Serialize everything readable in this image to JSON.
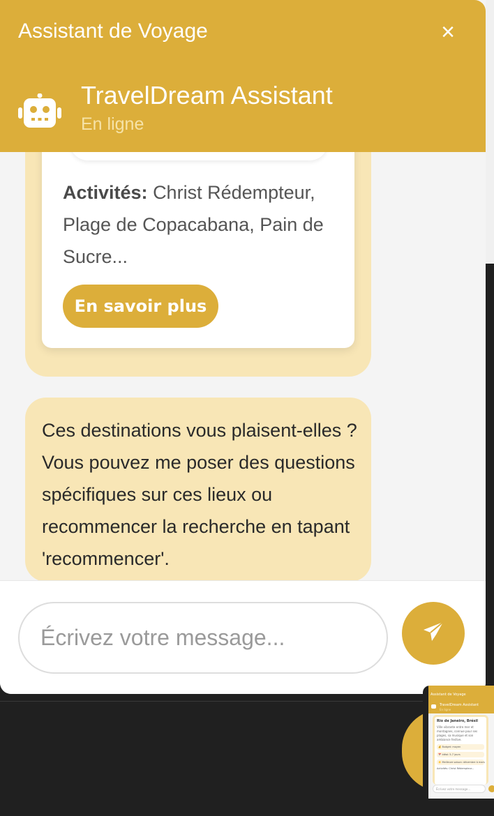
{
  "colors": {
    "accent": "#dcae3a",
    "bubble": "#f8e6b6",
    "status_text": "#f6e3a8",
    "background_dark": "#202020"
  },
  "chat": {
    "window_title": "Assistant de Voyage",
    "close_icon": "×",
    "assistant": {
      "name": "TravelDream Assistant",
      "status": "En ligne",
      "avatar_icon": "robot-icon"
    },
    "destination_card": {
      "activities_label": "Activités:",
      "activities_text": "Christ Rédempteur, Plage de Copacabana, Pain de Sucre...",
      "more_button": "En savoir plus"
    },
    "bot_message": "Ces destinations vous plaisent-elles ? Vous pouvez me poser des questions spécifiques sur ces lieux ou recommencer la recherche en tapant 'recommencer'.",
    "input": {
      "value": "",
      "placeholder": "Écrivez votre message..."
    },
    "send_icon": "paper-plane-icon"
  },
  "thumbnail": {
    "window_title": "Assistant de Voyage",
    "assistant_name": "TravelDream Assistant",
    "assistant_status": "En ligne",
    "city": "Rio de Janeiro, Brésil",
    "description": "Ville vibrante entre mer et montagnes, connue pour ses plages, sa musique et son ambiance festive.",
    "budget": "💰 Budget: moyen",
    "duration": "📅 Idéal: 5-7 jours",
    "season": "☀️ Meilleure saison: décembre à mars",
    "activities": "Activités: Christ Rédempteur...",
    "input_placeholder": "Écrivez votre message..."
  }
}
